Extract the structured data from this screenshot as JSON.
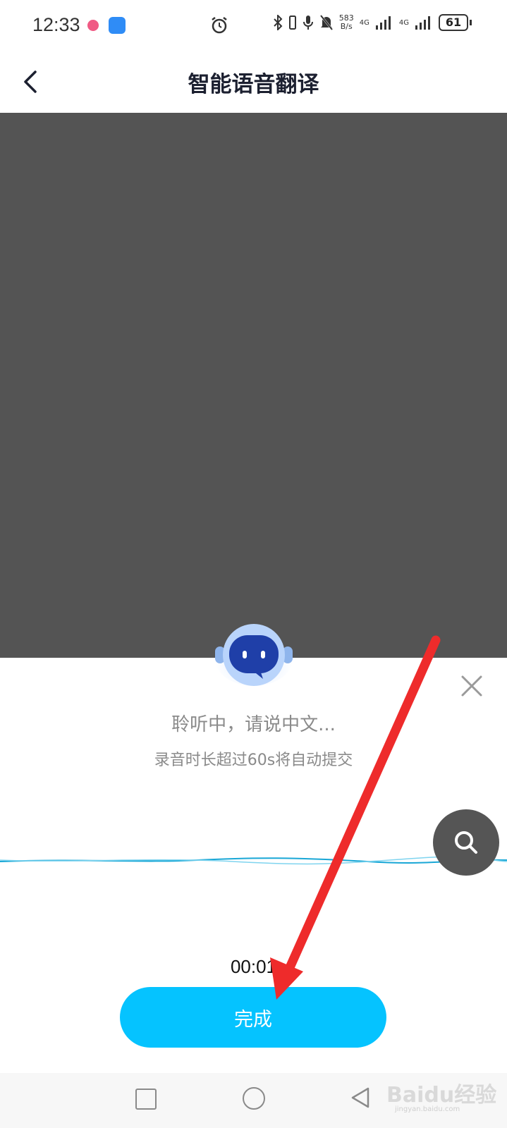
{
  "status_bar": {
    "time": "12:33",
    "net_speed_value": "583",
    "net_speed_unit": "B/s",
    "network_1": "4G",
    "network_2": "4G",
    "battery": "61"
  },
  "header": {
    "title": "智能语音翻译",
    "back_icon": "chevron-left-icon"
  },
  "voice_panel": {
    "listening_text": "聆听中，请说中文...",
    "hint_text": "录音时长超过60s将自动提交",
    "timer": "00:01",
    "done_label": "完成",
    "close_icon": "close-icon"
  },
  "floating": {
    "icon": "search-icon"
  },
  "watermark": {
    "main": "Baidu经验",
    "sub": "jingyan.baidu.com"
  },
  "colors": {
    "accent": "#05c3ff",
    "dark_overlay": "#545454",
    "robot_face": "#1f3fa8",
    "arrow": "#ee2b2b"
  }
}
